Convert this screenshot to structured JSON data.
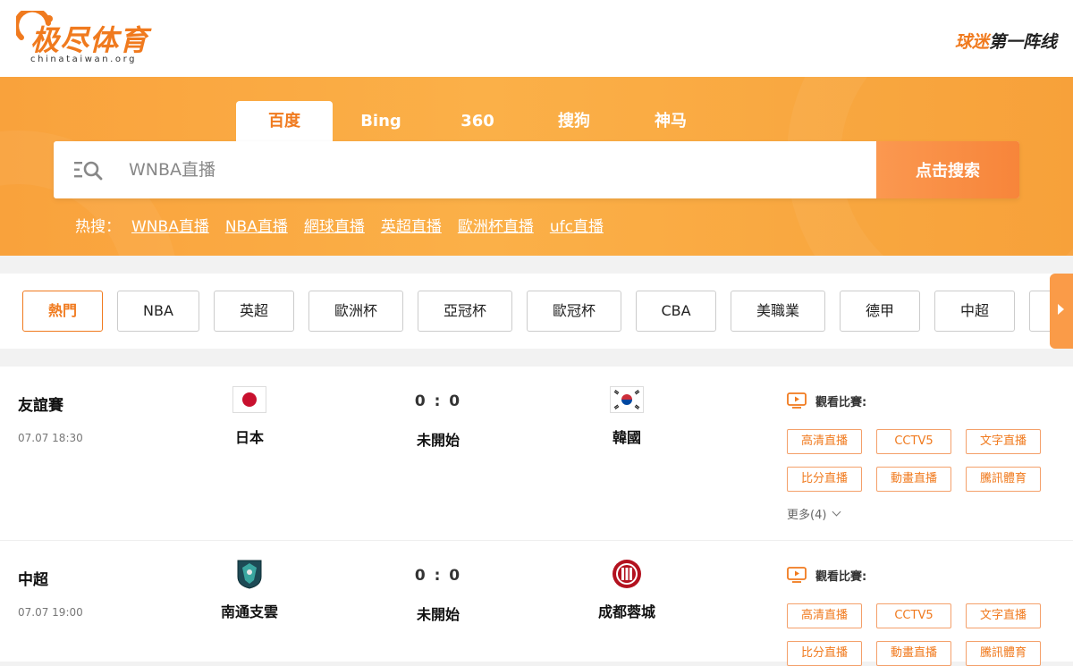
{
  "header": {
    "logo_text": "极尽体育",
    "logo_sub": "chinataiwan.org",
    "slogan_accent": "球迷",
    "slogan_rest": "第一阵线",
    "brand_color": "#f07a1e"
  },
  "search": {
    "tabs": [
      "百度",
      "Bing",
      "360",
      "搜狗",
      "神马"
    ],
    "active_tab": "百度",
    "placeholder": "WNBA直播",
    "button_label": "点击搜索",
    "hot_label": "热搜：",
    "hot_items": [
      "WNBA直播",
      "NBA直播",
      "網球直播",
      "英超直播",
      "歐洲杯直播",
      "ufc直播"
    ]
  },
  "categories": {
    "items": [
      "熱門",
      "NBA",
      "英超",
      "歐洲杯",
      "亞冠杯",
      "歐冠杯",
      "CBA",
      "美職業",
      "德甲",
      "中超"
    ],
    "active": "熱門",
    "next_icon": "chevron-right-icon"
  },
  "matches": [
    {
      "league": "友誼賽",
      "time": "07.07 18:30",
      "home": "日本",
      "home_icon": "japan-flag-icon",
      "score": "0 : 0",
      "status": "未開始",
      "away": "韓國",
      "away_icon": "korea-flag-icon",
      "watch_label": "觀看比賽:",
      "links": [
        "高清直播",
        "CCTV5",
        "文字直播",
        "比分直播",
        "動畫直播",
        "騰訊體育"
      ],
      "more": "更多(4)"
    },
    {
      "league": "中超",
      "time": "07.07 19:00",
      "home": "南通支雲",
      "home_icon": "nantong-zhiyun-badge-icon",
      "score": "0 : 0",
      "status": "未開始",
      "away": "成都蓉城",
      "away_icon": "chengdu-rongcheng-badge-icon",
      "watch_label": "觀看比賽:",
      "links": [
        "高清直播",
        "CCTV5",
        "文字直播",
        "比分直播",
        "動畫直播",
        "騰訊體育"
      ]
    }
  ]
}
